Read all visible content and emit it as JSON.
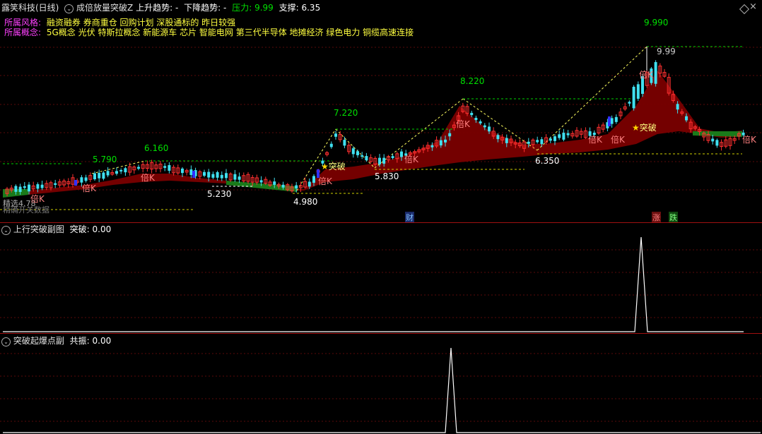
{
  "header": {
    "stock_name": "露笑科技(日线)",
    "indicator_name": "成倍放量突破Z",
    "up_label": "上升趋势:",
    "up_value": "-",
    "down_label": "下降趋势:",
    "down_value": "-",
    "pressure_label": "压力:",
    "pressure_value": "9.99",
    "support_label": "支撑:",
    "support_value": "6.35"
  },
  "info": {
    "style_label": "所属风格:",
    "style_value": "融资融券 券商重仓 回购计划 深股通标的 昨日较强",
    "concept_label": "所属概念:",
    "concept_value": "5G概念 光伏 特斯拉概念 新能源车 芯片 智能电网 第三代半导体 地摊经济 绿色电力 铜缆高速连接"
  },
  "main_chart": {
    "left_labels": [
      "精选4.78",
      "精确开关数据"
    ],
    "peak_labels": [
      "5.790",
      "6.160",
      "7.220",
      "8.220",
      "9.990"
    ],
    "trough_labels": [
      "5.230",
      "4.980",
      "5.830",
      "6.350"
    ],
    "last_high_label": "9.99",
    "markers": {
      "double_k": "倍K",
      "breakout": "突破",
      "finance": "财",
      "rise": "涨",
      "fall": "跌"
    }
  },
  "sub1": {
    "title": "上行突破副图",
    "value_label": "突破:",
    "value": "0.00"
  },
  "sub2": {
    "title": "突破起爆点副",
    "value_label": "共振:",
    "value": "0.00"
  },
  "colors": {
    "up": "#ff3030",
    "down": "#40e0f0",
    "band_up": "#8b0000",
    "band_down": "#1a7a1a",
    "label_green": "#00e000",
    "label_yellow": "#ffff40",
    "title_magenta": "#ff40ff"
  },
  "chart_data": {
    "type": "candlestick",
    "price_levels": {
      "pressure": 9.99,
      "support": 6.35
    },
    "marked_highs": [
      5.79,
      6.16,
      7.22,
      8.22,
      9.99
    ],
    "marked_lows": [
      5.23,
      4.98,
      5.83,
      6.35
    ],
    "sub1_value": 0.0,
    "sub2_value": 0.0
  }
}
